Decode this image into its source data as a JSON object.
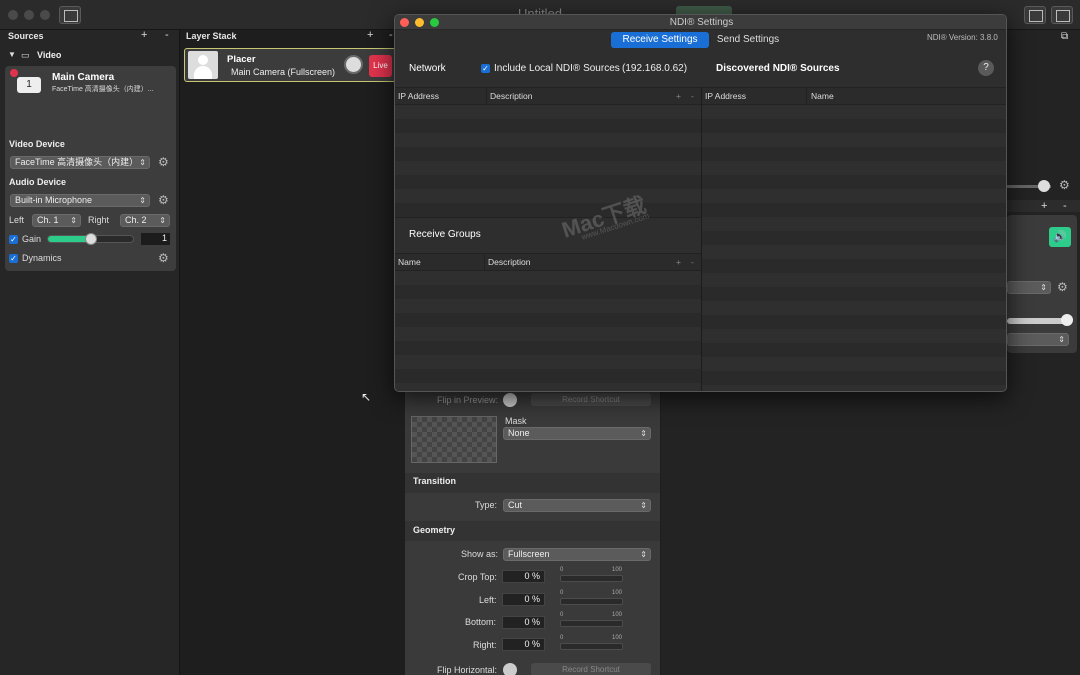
{
  "window": {
    "title": "Untitled"
  },
  "sources": {
    "header": "Sources",
    "add": "+",
    "remove": "-",
    "group_label": "Video",
    "camera": {
      "badge": "1",
      "title": "Main Camera",
      "subtitle": "FaceTime 高清摄像头（内建）..."
    },
    "video_device_label": "Video Device",
    "video_device_value": "FaceTime 高清摄像头（内建）",
    "audio_device_label": "Audio Device",
    "audio_device_value": "Built-in Microphone",
    "left_label": "Left",
    "left_value": "Ch. 1",
    "right_label": "Right",
    "right_value": "Ch. 2",
    "gain_label": "Gain",
    "gain_value": "1",
    "gain_level": 0.5,
    "dynamics_label": "Dynamics"
  },
  "layers": {
    "header": "Layer Stack",
    "add": "+",
    "remove": "-",
    "layer_title": "Placer",
    "layer_subtitle": "Main Camera (Fullscreen)",
    "live_label": "Live"
  },
  "inspector": {
    "flip_preview_label": "Flip in Preview:",
    "record_shortcut": "Record Shortcut",
    "mask_label": "Mask",
    "mask_value": "None",
    "transition_header": "Transition",
    "type_label": "Type:",
    "type_value": "Cut",
    "geometry_header": "Geometry",
    "show_as_label": "Show as:",
    "show_as_value": "Fullscreen",
    "crop_top_label": "Crop Top:",
    "left_label": "Left:",
    "bottom_label": "Bottom:",
    "right_label": "Right:",
    "crop_value": "0 %",
    "tick_min": "0",
    "tick_max": "100",
    "flip_horizontal_label": "Flip Horizontal:"
  },
  "ndi": {
    "title": "NDI® Settings",
    "tab_receive": "Receive Settings",
    "tab_send": "Send Settings",
    "version": "NDI® Version: 3.8.0",
    "network_label": "Network",
    "include_local": "Include Local NDI® Sources",
    "local_ip": "(192.168.0.62)",
    "discovered_label": "Discovered NDI® Sources",
    "help": "?",
    "col_ip": "IP Address",
    "col_description": "Description",
    "col_name": "Name",
    "add": "+",
    "remove": "-",
    "receive_groups_label": "Receive Groups"
  },
  "watermark": {
    "brand": "Mac下载",
    "url": "www.Macdown.com"
  },
  "colors": {
    "accent": "#1a6fd6",
    "live": "#e0334c",
    "gain": "#2ecc8a"
  }
}
